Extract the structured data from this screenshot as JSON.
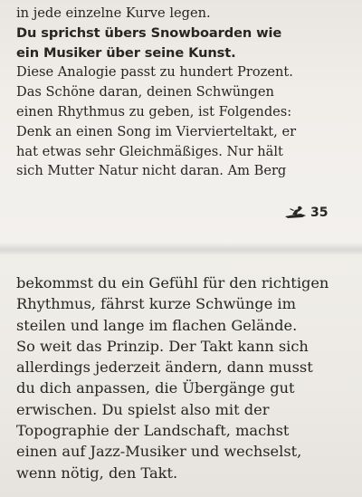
{
  "top_section": {
    "lines": [
      {
        "text": "in jede einzelne Kurve legen.",
        "bold": false
      },
      {
        "text": "Du sprichst übers Snowboarden wie",
        "bold": true
      },
      {
        "text": "ein Musiker über seine Kunst.",
        "bold": true
      },
      {
        "text": "Diese Analogie passt zu hundert Prozent.",
        "bold": false
      },
      {
        "text": "Das Schöne daran, deinen Schwüngen",
        "bold": false
      },
      {
        "text": "einen Rhythmus zu geben, ist Folgendes:",
        "bold": false
      },
      {
        "text": "Denk an einen Song im Viervierteltakt, er",
        "bold": false
      },
      {
        "text": "hat etwas sehr Gleichmäßiges. Nur hält",
        "bold": false
      },
      {
        "text": "sich Mutter Natur nicht daran. Am Berg",
        "bold": false
      }
    ],
    "page_number": "35",
    "page_marker_icon": "snowboarder-icon"
  },
  "bottom_section": {
    "lines": [
      "bekommst du ein Gefühl für den richtigen",
      "Rhythmus, fährst kurze Schwünge im",
      "steilen und lange im flachen Gelände.",
      "So weit das Prinzip. Der Takt kann sich",
      "allerdings jederzeit ändern, dann musst",
      "du dich anpassen, die Übergänge gut",
      "erwischen. Du spielst also mit der",
      "Topographie der Landschaft, machst",
      "einen auf Jazz-Musiker und wechselst,",
      "wenn nötig, den Takt."
    ]
  }
}
